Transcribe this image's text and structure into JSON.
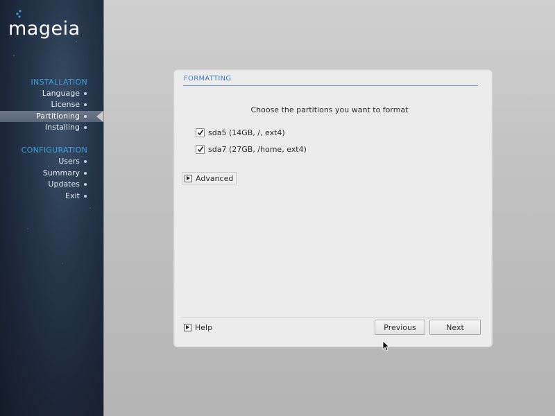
{
  "sidebar": {
    "logo_text": "mageia",
    "sections": [
      {
        "title": "INSTALLATION",
        "items": [
          {
            "label": "Language",
            "active": false
          },
          {
            "label": "License",
            "active": false
          },
          {
            "label": "Partitioning",
            "active": true
          },
          {
            "label": "Installing",
            "active": false
          }
        ]
      },
      {
        "title": "CONFIGURATION",
        "items": [
          {
            "label": "Users",
            "active": false
          },
          {
            "label": "Summary",
            "active": false
          },
          {
            "label": "Updates",
            "active": false
          },
          {
            "label": "Exit",
            "active": false
          }
        ]
      }
    ]
  },
  "dialog": {
    "title": "FORMATTING",
    "prompt": "Choose the partitions you want to format",
    "partitions": [
      {
        "label": "sda5 (14GB, /, ext4)",
        "checked": true
      },
      {
        "label": "sda7 (27GB, /home, ext4)",
        "checked": true
      }
    ],
    "advanced_label": "Advanced",
    "help_label": "Help",
    "previous_label": "Previous",
    "next_label": "Next"
  },
  "colors": {
    "accent": "#3ba0e0",
    "title_blue": "#3c79c2",
    "sidebar_bg": "#1a2536"
  }
}
